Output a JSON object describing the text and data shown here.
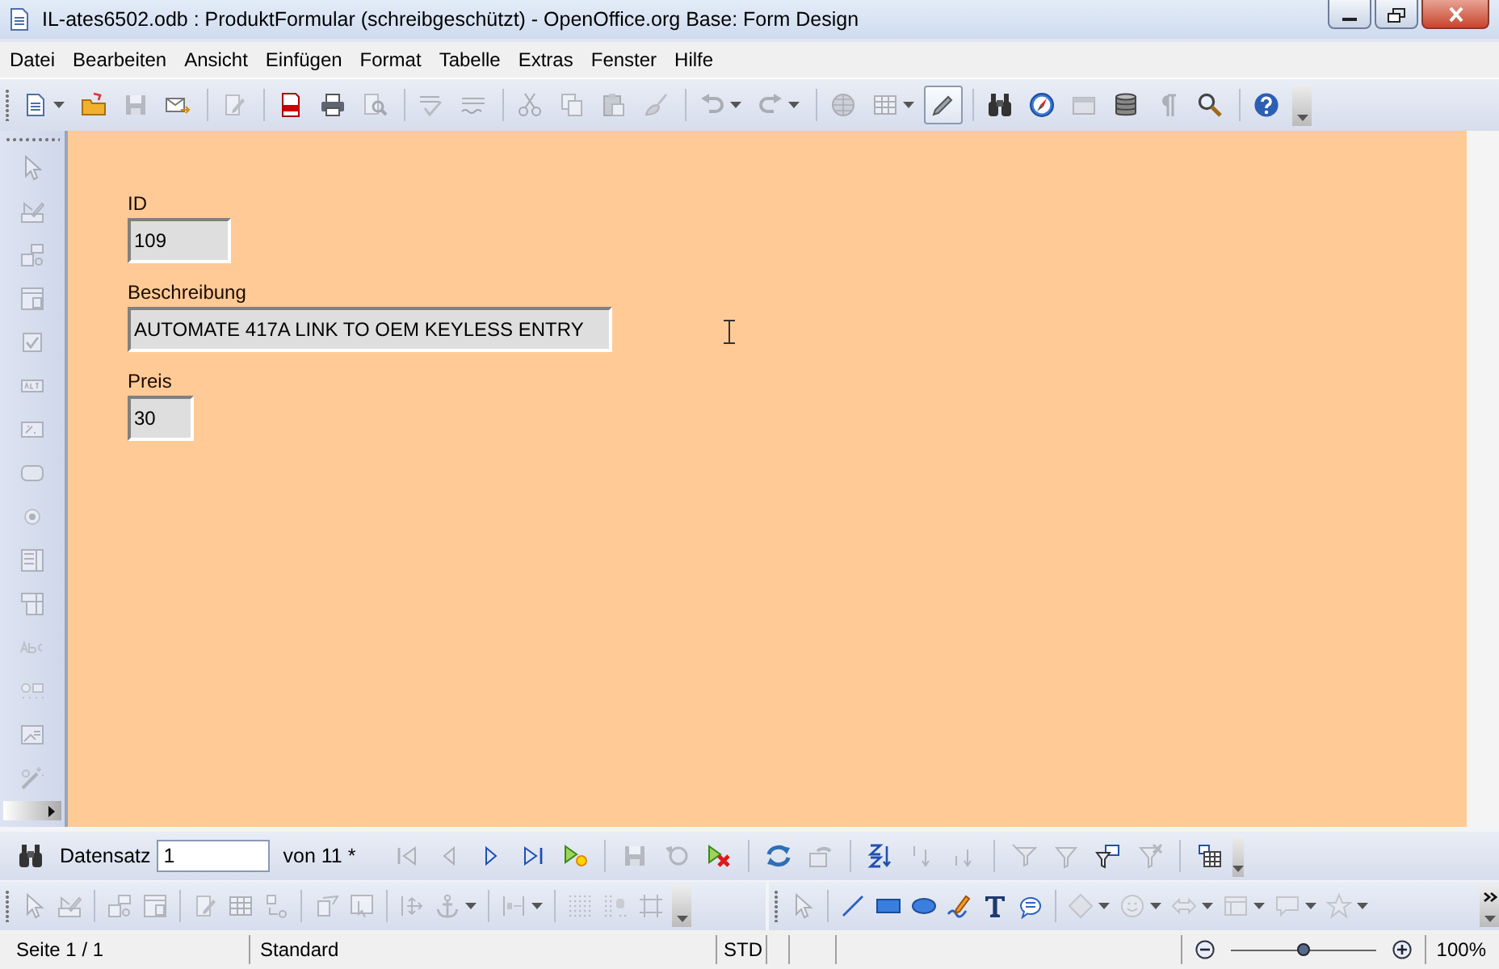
{
  "window": {
    "title": "IL-ates6502.odb : ProduktFormular (schreibgeschützt) - OpenOffice.org Base: Form Design"
  },
  "menu": [
    "Datei",
    "Bearbeiten",
    "Ansicht",
    "Einfügen",
    "Format",
    "Tabelle",
    "Extras",
    "Fenster",
    "Hilfe"
  ],
  "toolbar": [
    {
      "kind": "button",
      "disabled": false
    },
    {
      "kind": "button",
      "disabled": false
    },
    {
      "kind": "button",
      "disabled": true
    },
    {
      "kind": "button",
      "disabled": false
    },
    {
      "kind": "separator"
    },
    {
      "kind": "button",
      "disabled": true
    },
    {
      "kind": "separator"
    },
    {
      "kind": "button",
      "disabled": false
    },
    {
      "kind": "button",
      "disabled": false
    },
    {
      "kind": "button",
      "disabled": true
    },
    {
      "kind": "separator"
    },
    {
      "kind": "button",
      "disabled": true
    },
    {
      "kind": "button",
      "disabled": true
    },
    {
      "kind": "separator"
    },
    {
      "kind": "button",
      "disabled": true
    },
    {
      "kind": "button",
      "disabled": true
    },
    {
      "kind": "button",
      "disabled": true
    },
    {
      "kind": "button",
      "disabled": true
    },
    {
      "kind": "separator"
    },
    {
      "kind": "button",
      "disabled": true
    },
    {
      "kind": "button",
      "disabled": true
    },
    {
      "kind": "separator"
    },
    {
      "kind": "button",
      "disabled": true
    },
    {
      "kind": "button",
      "disabled": true
    },
    {
      "kind": "toggle",
      "on": true
    },
    {
      "kind": "separator"
    },
    {
      "kind": "button",
      "disabled": false
    },
    {
      "kind": "button",
      "disabled": false
    },
    {
      "kind": "button",
      "disabled": true
    },
    {
      "kind": "button",
      "disabled": false
    },
    {
      "kind": "button",
      "disabled": true
    },
    {
      "kind": "button",
      "disabled": false
    },
    {
      "kind": "separator"
    },
    {
      "kind": "button",
      "disabled": false
    }
  ],
  "controls_toolbar": [
    {
      "kind": "button",
      "disabled": true
    },
    {
      "kind": "button",
      "disabled": true
    },
    {
      "kind": "button",
      "disabled": true
    },
    {
      "kind": "button",
      "disabled": true
    },
    {
      "kind": "button",
      "disabled": true
    },
    {
      "kind": "button",
      "disabled": true
    },
    {
      "kind": "button",
      "disabled": true
    },
    {
      "kind": "button",
      "disabled": true
    },
    {
      "kind": "button",
      "disabled": true
    },
    {
      "kind": "button",
      "disabled": true
    },
    {
      "kind": "button",
      "disabled": true
    },
    {
      "kind": "button",
      "disabled": true
    },
    {
      "kind": "button",
      "disabled": true
    },
    {
      "kind": "button",
      "disabled": true
    },
    {
      "kind": "button",
      "disabled": true
    }
  ],
  "form": {
    "fields": [
      {
        "label": "ID",
        "value": "109"
      },
      {
        "label": "Beschreibung",
        "value": "AUTOMATE 417A LINK TO OEM KEYLESS ENTRY"
      },
      {
        "label": "Preis",
        "value": "30"
      }
    ]
  },
  "record_bar": {
    "label": "Datensatz",
    "value": "1",
    "count": "von 11 *",
    "buttons": [
      {
        "kind": "button",
        "disabled": false
      },
      {
        "kind": "label"
      },
      {
        "kind": "button",
        "disabled": true
      },
      {
        "kind": "button",
        "disabled": true
      },
      {
        "kind": "button",
        "disabled": false
      },
      {
        "kind": "button",
        "disabled": false
      },
      {
        "kind": "button",
        "disabled": false
      },
      {
        "kind": "separator"
      },
      {
        "kind": "button",
        "disabled": true
      },
      {
        "kind": "button",
        "disabled": true
      },
      {
        "kind": "button",
        "disabled": false
      },
      {
        "kind": "separator"
      },
      {
        "kind": "button",
        "disabled": false
      },
      {
        "kind": "button",
        "disabled": true
      },
      {
        "kind": "separator"
      },
      {
        "kind": "button",
        "disabled": false
      },
      {
        "kind": "button",
        "disabled": true
      },
      {
        "kind": "button",
        "disabled": true
      },
      {
        "kind": "separator"
      },
      {
        "kind": "button",
        "disabled": true
      },
      {
        "kind": "button",
        "disabled": true
      },
      {
        "kind": "button",
        "disabled": false
      },
      {
        "kind": "button",
        "disabled": true
      },
      {
        "kind": "separator"
      },
      {
        "kind": "button",
        "disabled": false
      }
    ]
  },
  "form_design_toolbar": [
    {
      "kind": "button",
      "disabled": true
    },
    {
      "kind": "button",
      "disabled": true
    },
    {
      "kind": "separator"
    },
    {
      "kind": "button",
      "disabled": true
    },
    {
      "kind": "button",
      "disabled": true
    },
    {
      "kind": "separator"
    },
    {
      "kind": "button",
      "disabled": true
    },
    {
      "kind": "button",
      "disabled": true
    },
    {
      "kind": "button",
      "disabled": true
    },
    {
      "kind": "separator"
    },
    {
      "kind": "button",
      "disabled": true
    },
    {
      "kind": "button",
      "disabled": true
    },
    {
      "kind": "separator"
    },
    {
      "kind": "button",
      "disabled": true
    },
    {
      "kind": "button",
      "disabled": true
    },
    {
      "kind": "separator"
    },
    {
      "kind": "button",
      "disabled": true
    },
    {
      "kind": "separator"
    },
    {
      "kind": "button",
      "disabled": true
    },
    {
      "kind": "button",
      "disabled": true
    },
    {
      "kind": "button",
      "disabled": true
    }
  ],
  "drawing_toolbar": [
    {
      "kind": "button",
      "disabled": true
    },
    {
      "kind": "separator"
    },
    {
      "kind": "button",
      "disabled": false
    },
    {
      "kind": "button",
      "disabled": false
    },
    {
      "kind": "button",
      "disabled": false
    },
    {
      "kind": "button",
      "disabled": false
    },
    {
      "kind": "button",
      "disabled": false
    },
    {
      "kind": "button",
      "disabled": false
    },
    {
      "kind": "separator"
    },
    {
      "kind": "button",
      "disabled": true
    },
    {
      "kind": "button",
      "disabled": true
    },
    {
      "kind": "button",
      "disabled": true
    },
    {
      "kind": "button",
      "disabled": true
    },
    {
      "kind": "button",
      "disabled": true
    },
    {
      "kind": "button",
      "disabled": true
    }
  ],
  "status_bar": {
    "page": "Seite 1 / 1",
    "style": "Standard",
    "mode": "STD",
    "zoom": {
      "level": 0.5
    },
    "zoom_value": "100%"
  }
}
